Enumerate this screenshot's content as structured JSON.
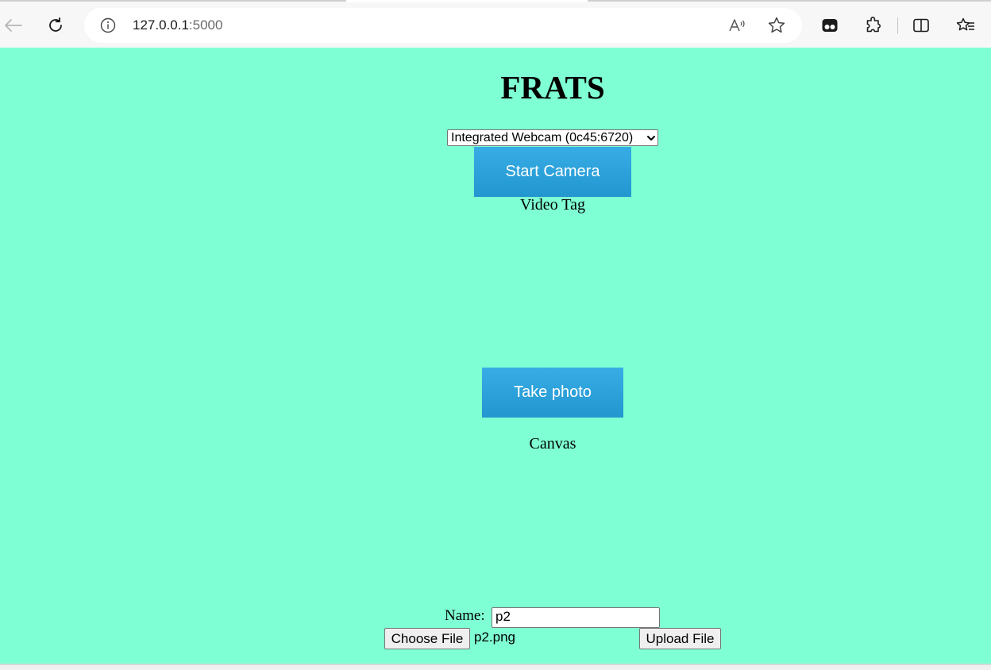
{
  "browser": {
    "url_host": "127.0.0.1",
    "url_port": ":5000"
  },
  "page": {
    "background": "#7fffd4",
    "title": "FRATS",
    "camera_select": {
      "selected": "Integrated Webcam (0c45:6720)"
    },
    "start_camera_label": "Start Camera",
    "video_caption": "Video Tag",
    "take_photo_label": "Take photo",
    "canvas_caption": "Canvas",
    "form": {
      "name_label": "Name:",
      "name_value": "p2",
      "choose_file_label": "Choose File",
      "file_name": "p2.png",
      "upload_label": "Upload File"
    }
  },
  "colors": {
    "button_blue": "#2a9fd8",
    "page_bg": "#7fffd4"
  },
  "icons": [
    "back-arrow-icon",
    "refresh-icon",
    "info-icon",
    "read-aloud-icon",
    "favorite-star-icon",
    "tab-actions-icon",
    "extensions-icon",
    "split-screen-icon",
    "favorites-icon",
    "chevron-down-icon"
  ]
}
